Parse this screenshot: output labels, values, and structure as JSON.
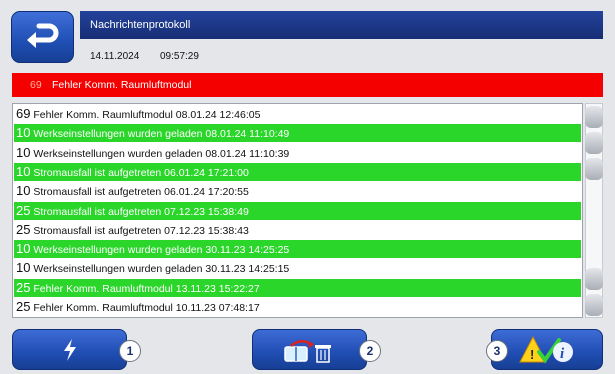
{
  "header": {
    "title": "Nachrichtenprotokoll",
    "date": "14.11.2024",
    "time": "09:57:29"
  },
  "current_error": {
    "code": "69",
    "text": "Fehler Komm. Raumluftmodul"
  },
  "log_entries": [
    {
      "code": "69",
      "text": "Fehler Komm. Raumluftmodul 08.01.24 12:46:05",
      "style": "white"
    },
    {
      "code": "10",
      "text": "Werkseinstellungen wurden geladen 08.01.24 11:10:49",
      "style": "green"
    },
    {
      "code": "10",
      "text": "Werkseinstellungen wurden geladen 08.01.24 11:10:39",
      "style": "white"
    },
    {
      "code": "10",
      "text": "Stromausfall ist aufgetreten 06.01.24 17:21:00",
      "style": "green"
    },
    {
      "code": "10",
      "text": "Stromausfall ist aufgetreten 06.01.24 17:20:55",
      "style": "white"
    },
    {
      "code": "25",
      "text": "Stromausfall ist aufgetreten 07.12.23 15:38:49",
      "style": "green"
    },
    {
      "code": "25",
      "text": "Stromausfall ist aufgetreten 07.12.23 15:38:43",
      "style": "white"
    },
    {
      "code": "10",
      "text": "Werkseinstellungen wurden geladen 30.11.23 14:25:25",
      "style": "green"
    },
    {
      "code": "10",
      "text": "Werkseinstellungen wurden geladen 30.11.23 14:25:15",
      "style": "white"
    },
    {
      "code": "25",
      "text": "Fehler Komm. Raumluftmodul 13.11.23 15:22:27",
      "style": "green"
    },
    {
      "code": "25",
      "text": "Fehler Komm. Raumluftmodul 10.11.23 07:48:17",
      "style": "white"
    }
  ],
  "bottom_nav": {
    "badge1": "1",
    "badge2": "2",
    "badge3": "3",
    "icons": [
      "lightning-icon",
      "book-trash-icon",
      "warning-check-info-icon"
    ]
  },
  "colors": {
    "header_blue": "#1d3a8f",
    "error_red": "#f40000",
    "row_green": "#2bd62b",
    "button_blue": "#1f4db2"
  }
}
